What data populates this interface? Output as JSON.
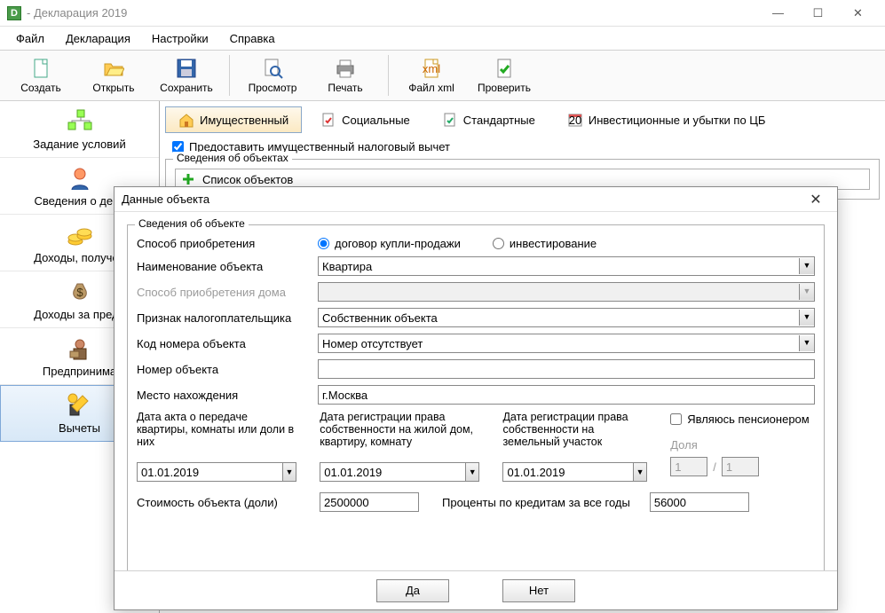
{
  "window": {
    "title": " - Декларация 2019"
  },
  "menu": {
    "file": "Файл",
    "decl": "Декларация",
    "settings": "Настройки",
    "help": "Справка"
  },
  "toolbar": {
    "create": "Создать",
    "open": "Открыть",
    "save": "Сохранить",
    "preview": "Просмотр",
    "print": "Печать",
    "xml": "Файл xml",
    "check": "Проверить"
  },
  "sidebar": {
    "cond": "Задание условий",
    "declinfo": "Сведения о декл",
    "income": "Доходы, получен",
    "foreign": "Доходы за преде",
    "entrep": "Предпринима",
    "deduct": "Вычеты"
  },
  "tabs": {
    "property": "Имущественный",
    "social": "Социальные",
    "standard": "Стандартные",
    "invest": "Инвестиционные и убытки по ЦБ"
  },
  "group": {
    "provide": "Предоставить имущественный налоговый вычет",
    "objects_title": "Сведения об объектах",
    "list_head": "Список объектов"
  },
  "dialog": {
    "title": "Данные объекта",
    "group_title": "Сведения об объекте",
    "method_label": "Способ приобретения",
    "method_contract": "договор купли-продажи",
    "method_invest": "инвестирование",
    "name_label": "Наименование объекта",
    "name_value": "Квартира",
    "house_method_label": "Способ приобретения дома",
    "taxpayer_label": "Признак налогоплательщика",
    "taxpayer_value": "Собственник объекта",
    "code_label": "Код номера объекта",
    "code_value": "Номер отсутствует",
    "number_label": "Номер объекта",
    "number_value": "",
    "location_label": "Место нахождения",
    "location_value": "г.Москва",
    "date_act_label": "Дата акта о передаче квартиры, комнаты или доли в них",
    "date_act": "01.01.2019",
    "date_reg_label": "Дата регистрации права собственности на жилой дом, квартиру, комнату",
    "date_reg": "01.01.2019",
    "date_land_label": "Дата регистрации права собственности на земельный участок",
    "date_land": "01.01.2019",
    "pensioner": "Являюсь пенсионером",
    "share_label": "Доля",
    "share_a": "1",
    "share_b": "1",
    "cost_label": "Стоимость объекта (доли)",
    "cost": "2500000",
    "interest_label": "Проценты по кредитам за все годы",
    "interest": "56000",
    "ok": "Да",
    "cancel": "Нет"
  }
}
